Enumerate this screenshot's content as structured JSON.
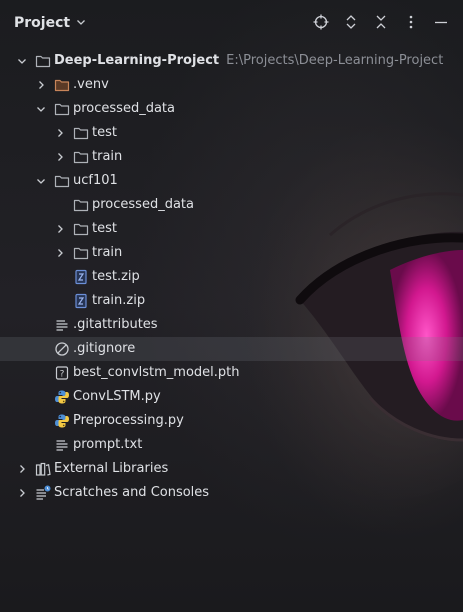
{
  "header": {
    "title": "Project",
    "actions": [
      {
        "name": "locate-icon"
      },
      {
        "name": "expand-all-icon"
      },
      {
        "name": "collapse-all-icon"
      },
      {
        "name": "more-icon"
      },
      {
        "name": "minimize-icon"
      }
    ]
  },
  "tree": [
    {
      "label": "Deep-Learning-Project",
      "path": "E:\\Projects\\Deep-Learning-Project",
      "icon": "folder-icon",
      "depth": 0,
      "arrow": "down",
      "bold": true
    },
    {
      "label": ".venv",
      "icon": "venv-folder-icon",
      "depth": 1,
      "arrow": "right"
    },
    {
      "label": "processed_data",
      "icon": "folder-icon",
      "depth": 1,
      "arrow": "down"
    },
    {
      "label": "test",
      "icon": "folder-icon",
      "depth": 2,
      "arrow": "right"
    },
    {
      "label": "train",
      "icon": "folder-icon",
      "depth": 2,
      "arrow": "right"
    },
    {
      "label": "ucf101",
      "icon": "folder-icon",
      "depth": 1,
      "arrow": "down"
    },
    {
      "label": "processed_data",
      "icon": "folder-icon",
      "depth": 2,
      "arrow": "none"
    },
    {
      "label": "test",
      "icon": "folder-icon",
      "depth": 2,
      "arrow": "right"
    },
    {
      "label": "train",
      "icon": "folder-icon",
      "depth": 2,
      "arrow": "right"
    },
    {
      "label": "test.zip",
      "icon": "zip-file-icon",
      "depth": 2,
      "arrow": "none"
    },
    {
      "label": "train.zip",
      "icon": "zip-file-icon",
      "depth": 2,
      "arrow": "none"
    },
    {
      "label": ".gitattributes",
      "icon": "text-file-icon",
      "depth": 1,
      "arrow": "none"
    },
    {
      "label": ".gitignore",
      "icon": "ignore-file-icon",
      "depth": 1,
      "arrow": "none",
      "selected": true
    },
    {
      "label": "best_convlstm_model.pth",
      "icon": "unknown-file-icon",
      "depth": 1,
      "arrow": "none"
    },
    {
      "label": "ConvLSTM.py",
      "icon": "python-file-icon",
      "depth": 1,
      "arrow": "none"
    },
    {
      "label": "Preprocessing.py",
      "icon": "python-file-icon",
      "depth": 1,
      "arrow": "none"
    },
    {
      "label": "prompt.txt",
      "icon": "text-file-icon",
      "depth": 1,
      "arrow": "none"
    },
    {
      "label": "External Libraries",
      "icon": "libraries-icon",
      "depth": 0,
      "arrow": "right"
    },
    {
      "label": "Scratches and Consoles",
      "icon": "scratches-icon",
      "depth": 0,
      "arrow": "right"
    }
  ],
  "colors": {
    "text": "#dfe1e5",
    "path": "#8c8f96",
    "selection": "#3a3c42",
    "folder_stroke": "#aeb2b8",
    "venv_folder_stroke": "#c7855a",
    "zip_icon": "#6c8fd8",
    "python_blue": "#4e8fd6",
    "python_yellow": "#f3c843",
    "eye_iris": "#d2188f"
  }
}
